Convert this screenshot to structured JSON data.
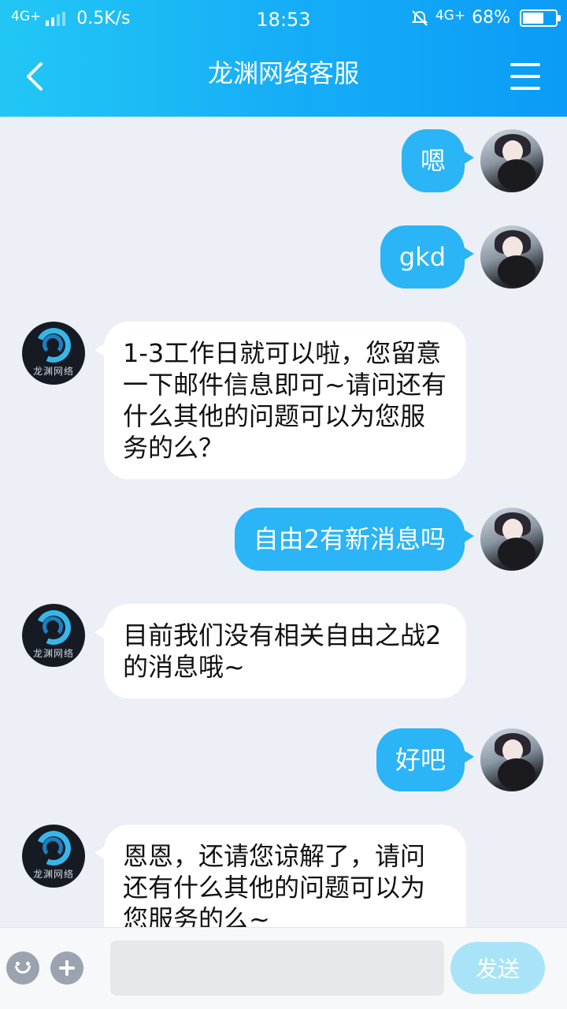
{
  "status_bar": {
    "network_left": "4G+",
    "speed": "0.5K/s",
    "time": "18:53",
    "network_right": "4G+",
    "battery": "68%",
    "battery_level": 0.68
  },
  "header": {
    "title": "龙渊网络客服"
  },
  "bot": {
    "brand": "龙渊网络"
  },
  "messages": [
    {
      "from": "user",
      "text": "嗯"
    },
    {
      "from": "user",
      "text": "gkd"
    },
    {
      "from": "bot",
      "text": "1-3工作日就可以啦，您留意一下邮件信息即可~请问还有什么其他的问题可以为您服务的么？"
    },
    {
      "from": "user",
      "text": "自由2有新消息吗"
    },
    {
      "from": "bot",
      "text": "目前我们没有相关自由之战2的消息哦~"
    },
    {
      "from": "user",
      "text": "好吧"
    },
    {
      "from": "bot",
      "text": "恩恩，还请您谅解了，请问还有什么其他的问题可以为您服务的么~"
    }
  ],
  "input_bar": {
    "placeholder": "",
    "send_label": "发送"
  },
  "colors": {
    "header_start": "#22c7f5",
    "header_end": "#0b9cf7",
    "user_bubble": "#2bb4f6",
    "send_button": "#a9e3f8",
    "background": "#eceff5"
  }
}
